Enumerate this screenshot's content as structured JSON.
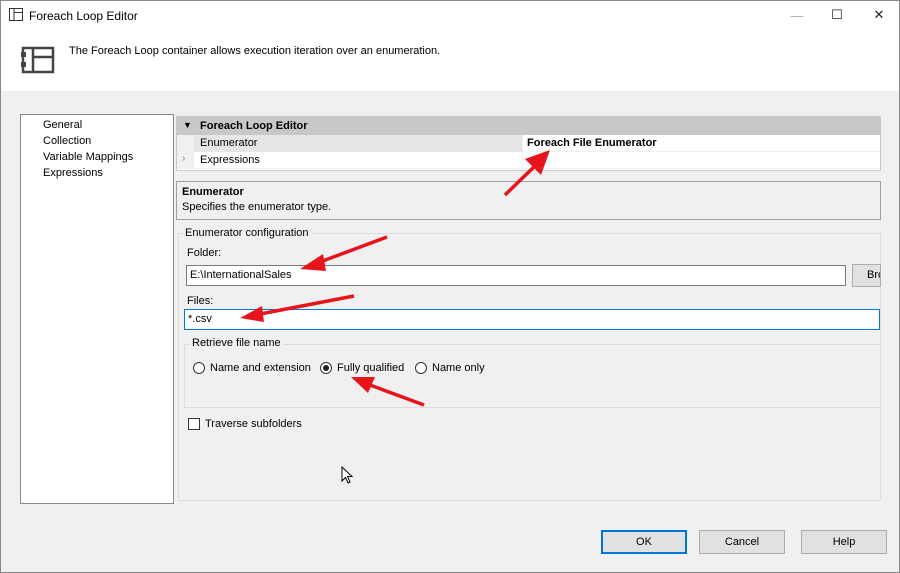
{
  "window": {
    "title": "Foreach Loop Editor",
    "controls": {
      "minimize": "—",
      "maximize": "☐",
      "close": "✕"
    }
  },
  "header": {
    "description": "The Foreach Loop container allows execution iteration over an enumeration.",
    "icon": "foreach-loop-container-icon"
  },
  "nav": {
    "items": [
      {
        "label": "General"
      },
      {
        "label": "Collection",
        "selected": true
      },
      {
        "label": "Variable Mappings"
      },
      {
        "label": "Expressions"
      }
    ]
  },
  "property_grid": {
    "category": "Foreach Loop Editor",
    "rows": [
      {
        "name": "Enumerator",
        "value": "Foreach File Enumerator"
      },
      {
        "name": "Expressions",
        "value": ""
      }
    ]
  },
  "description_panel": {
    "title": "Enumerator",
    "text": "Specifies the enumerator type."
  },
  "enumerator_config": {
    "group_label": "Enumerator configuration",
    "folder_label": "Folder:",
    "folder_value": "E:\\InternationalSales",
    "browse_label": "Browse...",
    "files_label": "Files:",
    "files_value": "*.csv",
    "retrieve_label": "Retrieve file name",
    "options": [
      {
        "label": "Name and extension",
        "selected": false
      },
      {
        "label": "Fully qualified",
        "selected": true
      },
      {
        "label": "Name only",
        "selected": false
      }
    ],
    "traverse_label": "Traverse subfolders",
    "traverse_checked": false
  },
  "buttons": {
    "ok": "OK",
    "cancel": "Cancel",
    "help": "Help"
  },
  "colors": {
    "accent": "#0078d7",
    "annotation_arrow": "#e8141c",
    "panel_bg": "#f0f0f0"
  }
}
